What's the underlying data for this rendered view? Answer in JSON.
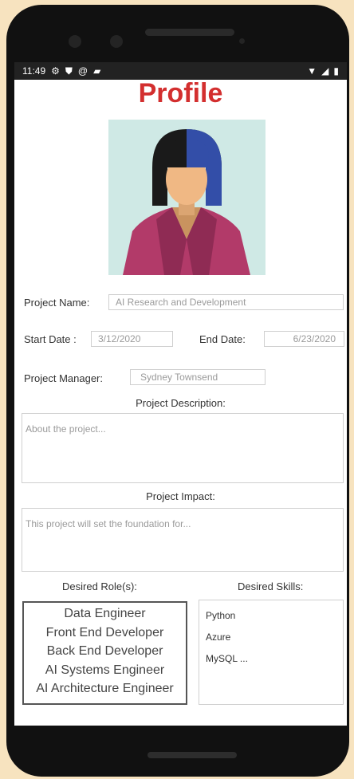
{
  "status_bar": {
    "time": "11:49",
    "icons": [
      "gear-icon",
      "shield-icon",
      "at-icon",
      "sd-card-icon"
    ],
    "right_icons": [
      "wifi-icon",
      "signal-icon",
      "battery-icon"
    ]
  },
  "page": {
    "title": "Profile",
    "title_color": "#d32f2f"
  },
  "form": {
    "project_name_label": "Project  Name:",
    "project_name_value": "AI Research and Development",
    "start_date_label": "Start Date :",
    "start_date_value": "3/12/2020",
    "end_date_label": "End  Date:",
    "end_date_value": "6/23/2020",
    "project_manager_label": "Project Manager:",
    "project_manager_value": "Sydney Townsend",
    "description_label": "Project  Description:",
    "description_placeholder": "About the project...",
    "impact_label": "Project Impact:",
    "impact_placeholder": "This project will set the foundation for..."
  },
  "roles": {
    "label": "Desired Role(s):",
    "items": [
      "Data Engineer",
      "Front End Developer",
      "Back End Developer",
      "AI Systems Engineer",
      "AI Architecture Engineer"
    ]
  },
  "skills": {
    "label": "Desired Skills:",
    "items": [
      "Python",
      "Azure",
      "MySQL ..."
    ]
  }
}
